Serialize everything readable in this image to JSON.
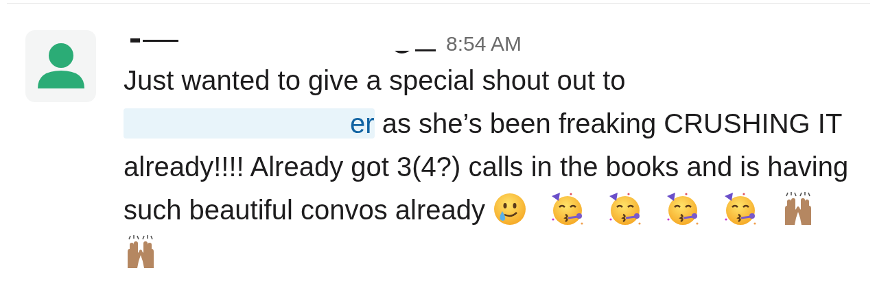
{
  "message": {
    "time": "8:54 AM",
    "text_before": "Just wanted to give a special shout out to",
    "mention": "er",
    "text_after": " as she’s been freaking CRUSHING IT already!!!! Already got 3(4?) calls in the books and is having such beautiful convos already",
    "emojis": [
      {
        "kind": "smile-tear"
      },
      {
        "kind": "party"
      },
      {
        "kind": "party"
      },
      {
        "kind": "party"
      },
      {
        "kind": "party"
      },
      {
        "kind": "raised-hands"
      },
      {
        "kind": "raised-hands"
      }
    ]
  }
}
